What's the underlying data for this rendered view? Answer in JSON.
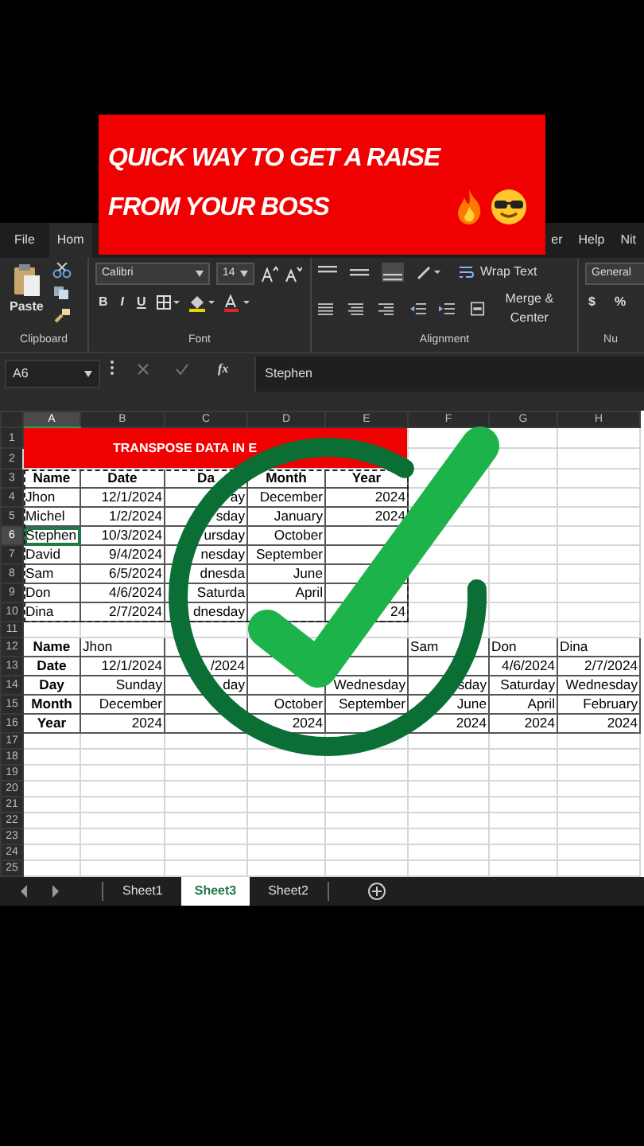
{
  "banner": {
    "title": "QUICK WAY TO GET A RAISE FROM YOUR BOSS"
  },
  "ribbon_tabs": [
    {
      "label": "File",
      "selected": false
    },
    {
      "label": "Hom",
      "selected": true
    },
    {
      "label": "er",
      "selected": false
    },
    {
      "label": "Help",
      "selected": false
    },
    {
      "label": "Nit",
      "selected": false
    }
  ],
  "ribbon": {
    "paste_label": "Paste",
    "font_name": "Calibri",
    "font_size": "14",
    "style_buttons": [
      "B",
      "I",
      "U"
    ],
    "wrap_text": "Wrap Text",
    "merge_center": "Merge & Center",
    "number_format": "General",
    "currency": "$",
    "percent": "%",
    "groups": [
      "Clipboard",
      "Font",
      "Alignment",
      "Nu"
    ]
  },
  "formula_bar": {
    "name_box": "A6",
    "function_label": "fx",
    "value": "Stephen"
  },
  "sheet": {
    "copy_marquee": true,
    "columns": [
      {
        "label": "A",
        "selected": true
      },
      {
        "label": "B",
        "selected": false
      },
      {
        "label": "C",
        "selected": false
      },
      {
        "label": "D",
        "selected": false
      },
      {
        "label": "E",
        "selected": false
      },
      {
        "label": "F",
        "selected": false
      },
      {
        "label": "G",
        "selected": false
      },
      {
        "label": "H",
        "selected": false
      }
    ],
    "rows": [
      {
        "number": "1",
        "kind": "title",
        "selected": false,
        "title": "TRANSPOSE DATA IN E"
      },
      {
        "number": "2",
        "kind": "title-continued",
        "selected": false
      },
      {
        "number": "3",
        "kind": "header",
        "selected": false,
        "cells": [
          "Name",
          "Date",
          "Da",
          "Month",
          "Year"
        ]
      },
      {
        "number": "4",
        "kind": "data",
        "selected": false,
        "cells": [
          "Jhon",
          "12/1/2024",
          "ay",
          "December",
          "2024"
        ]
      },
      {
        "number": "5",
        "kind": "data",
        "selected": false,
        "cells": [
          "Michel",
          "1/2/2024",
          "sday",
          "January",
          "2024"
        ]
      },
      {
        "number": "6",
        "kind": "data",
        "selected": true,
        "cells": [
          "Stephen",
          "10/3/2024",
          "ursday",
          "October",
          null
        ]
      },
      {
        "number": "7",
        "kind": "data",
        "selected": false,
        "cells": [
          "David",
          "9/4/2024",
          "nesday",
          "September",
          null
        ]
      },
      {
        "number": "8",
        "kind": "data",
        "selected": false,
        "cells": [
          "Sam",
          "6/5/2024",
          "dnesda",
          "June",
          null
        ]
      },
      {
        "number": "9",
        "kind": "data",
        "selected": false,
        "cells": [
          "Don",
          "4/6/2024",
          "Saturda",
          "April",
          null
        ]
      },
      {
        "number": "10",
        "kind": "data",
        "selected": false,
        "cells": [
          "Dina",
          "2/7/2024",
          "dnesday",
          null,
          "24"
        ]
      },
      {
        "number": "11",
        "kind": "blank",
        "selected": false
      },
      {
        "number": "12",
        "kind": "transposed-names",
        "selected": false,
        "cells": [
          "Name",
          "Jhon",
          null,
          null,
          null,
          "Sam",
          "Don",
          "Dina"
        ]
      },
      {
        "number": "13",
        "kind": "transposed",
        "selected": false,
        "cells": [
          "Date",
          "12/1/2024",
          "/2024",
          null,
          null,
          null,
          "4/6/2024",
          "2/7/2024"
        ]
      },
      {
        "number": "14",
        "kind": "transposed",
        "selected": false,
        "cells": [
          "Day",
          "Sunday",
          "day",
          null,
          "Wednesday",
          "sday",
          "Saturday",
          "Wednesday"
        ]
      },
      {
        "number": "15",
        "kind": "transposed",
        "selected": false,
        "cells": [
          "Month",
          "December",
          null,
          "October",
          "September",
          "June",
          "April",
          "February"
        ]
      },
      {
        "number": "16",
        "kind": "transposed",
        "selected": false,
        "cells": [
          "Year",
          "2024",
          null,
          "2024",
          null,
          "2024",
          "2024",
          "2024"
        ]
      },
      {
        "number": "17",
        "kind": "blank",
        "selected": false
      },
      {
        "number": "18",
        "kind": "blank",
        "selected": false
      },
      {
        "number": "19",
        "kind": "blank",
        "selected": false
      },
      {
        "number": "20",
        "kind": "blank",
        "selected": false
      },
      {
        "number": "21",
        "kind": "blank",
        "selected": false
      },
      {
        "number": "22",
        "kind": "blank",
        "selected": false
      },
      {
        "number": "23",
        "kind": "blank",
        "selected": false
      },
      {
        "number": "24",
        "kind": "blank",
        "selected": false
      },
      {
        "number": "25",
        "kind": "blank",
        "selected": false
      }
    ]
  },
  "sheet_tabs": [
    {
      "label": "Sheet1",
      "selected": false
    },
    {
      "label": "Sheet3",
      "selected": true
    },
    {
      "label": "Sheet2",
      "selected": false
    }
  ]
}
